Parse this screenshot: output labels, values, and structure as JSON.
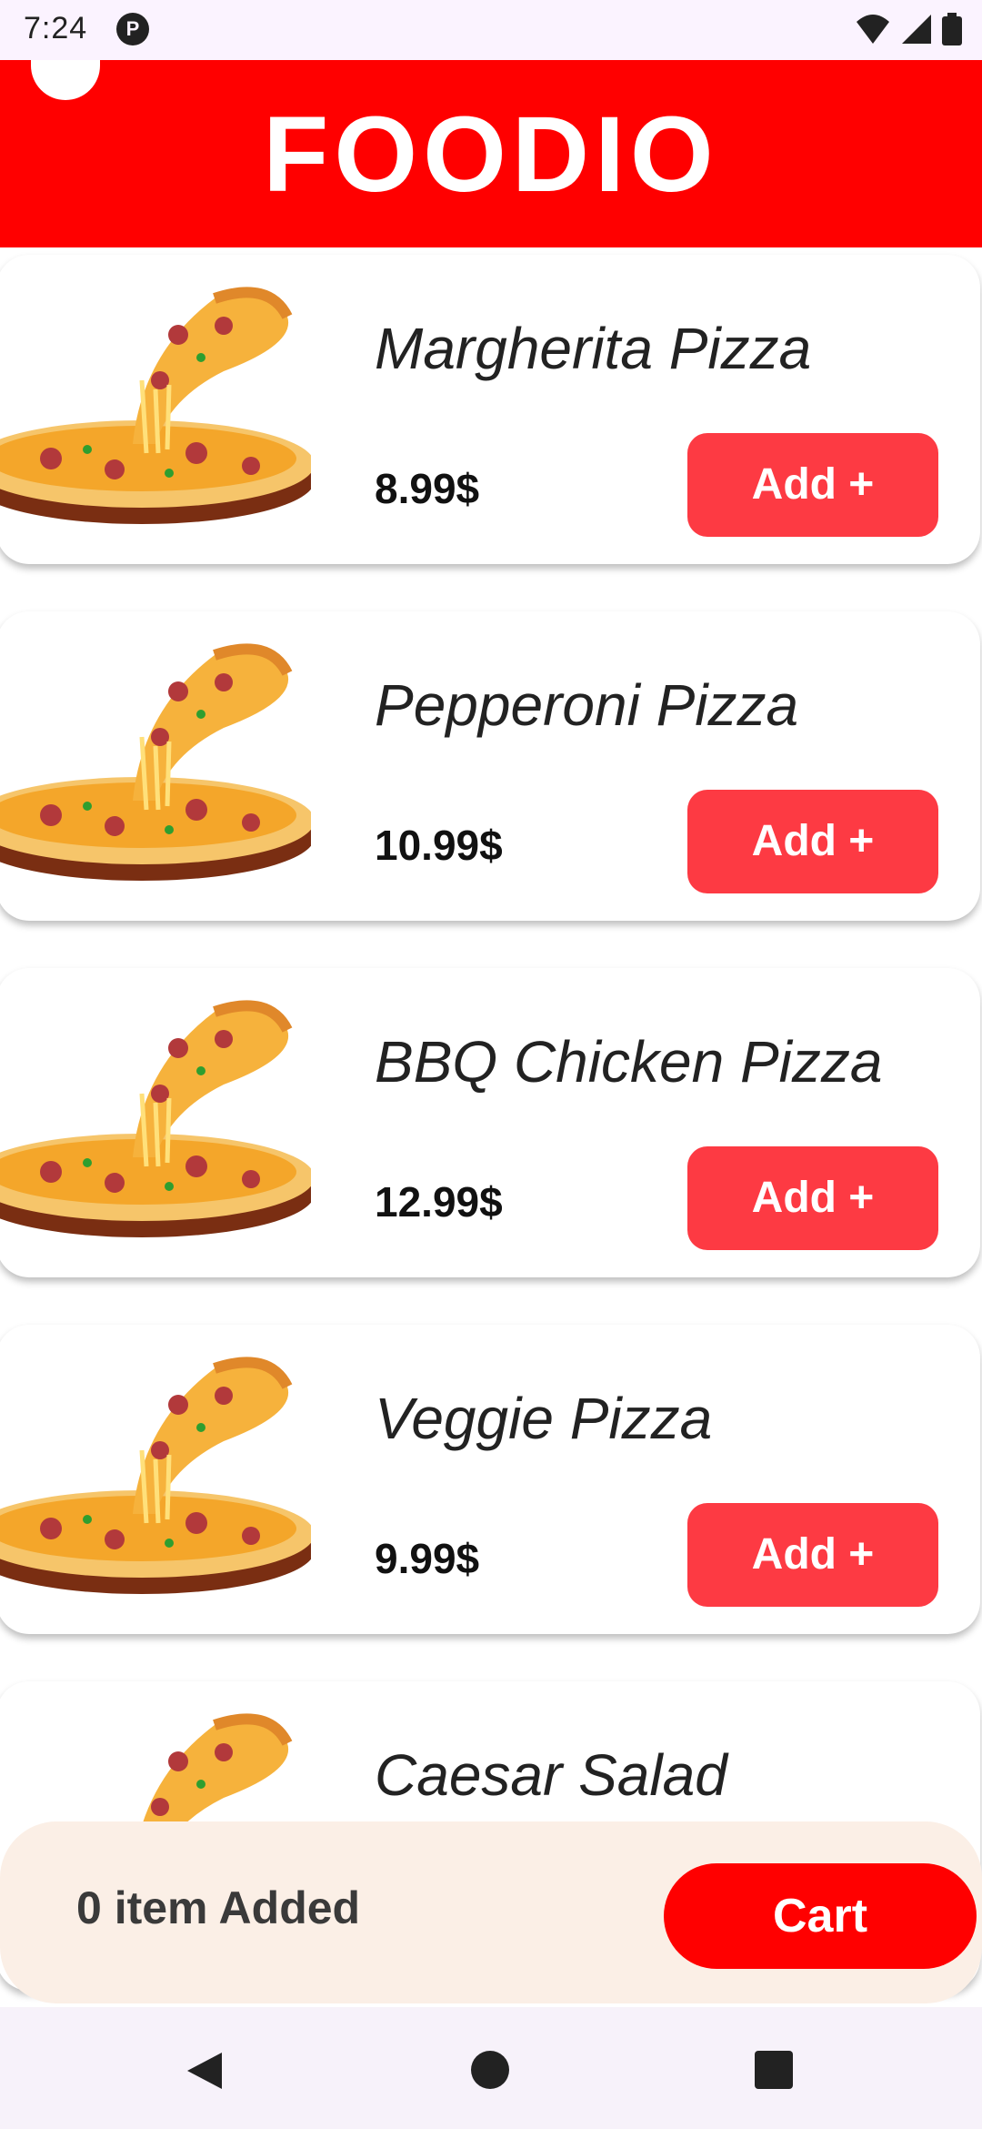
{
  "status_bar": {
    "time": "7:24",
    "app_icon": "P",
    "icons": [
      "wifi-icon",
      "signal-icon",
      "battery-icon"
    ]
  },
  "header": {
    "title": "FOODIO",
    "color": "#ff0000"
  },
  "menu": {
    "items": [
      {
        "name": "Margherita Pizza",
        "price": "8.99$",
        "button": "Add +",
        "image": "pizza-icon"
      },
      {
        "name": "Pepperoni Pizza",
        "price": "10.99$",
        "button": "Add +",
        "image": "pizza-icon"
      },
      {
        "name": "BBQ Chicken Pizza",
        "price": "12.99$",
        "button": "Add +",
        "image": "pizza-icon"
      },
      {
        "name": "Veggie Pizza",
        "price": "9.99$",
        "button": "Add +",
        "image": "pizza-icon"
      },
      {
        "name": "Caesar Salad",
        "price": "",
        "button": "",
        "image": "pizza-icon"
      }
    ]
  },
  "cart": {
    "count_label": "0 item Added",
    "button_label": "Cart",
    "accent": "#ff0000",
    "bar_color": "#fbefe6"
  },
  "nav": {
    "icons": [
      "back-icon",
      "home-icon",
      "recents-icon"
    ]
  },
  "colors": {
    "add_button": "#fd3a43"
  }
}
